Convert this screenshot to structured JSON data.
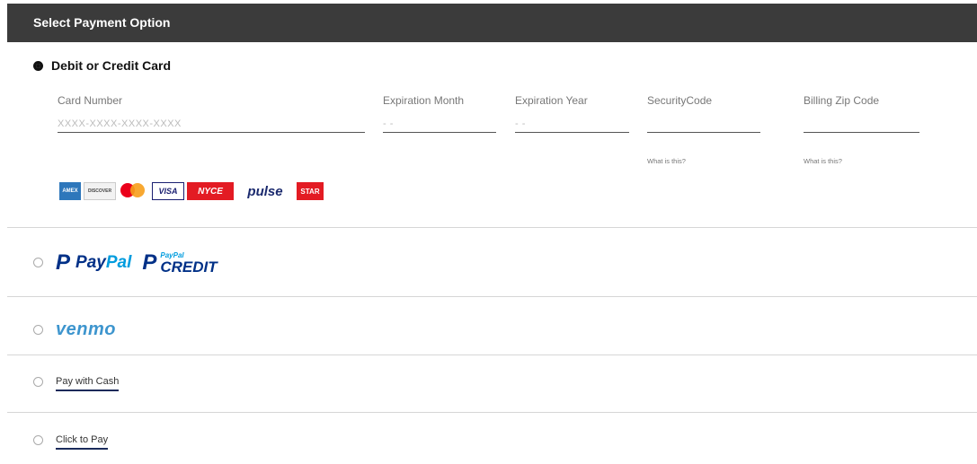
{
  "header": {
    "title": "Select Payment Option"
  },
  "card_option": {
    "title": "Debit or Credit Card",
    "selected": true,
    "fields": {
      "card_number": {
        "label": "Card Number",
        "placeholder": "XXXX-XXXX-XXXX-XXXX"
      },
      "exp_month": {
        "label": "Expiration Month",
        "placeholder": "- -"
      },
      "exp_year": {
        "label": "Expiration Year",
        "placeholder": "- -"
      },
      "security_code": {
        "label": "SecurityCode",
        "help": "What is this?"
      },
      "billing_zip": {
        "label": "Billing Zip Code",
        "help": "What is this?"
      }
    },
    "brands": {
      "amex": "AMEX",
      "discover": "DISCOVER",
      "mastercard": "mastercard",
      "visa": "VISA",
      "nyce": "NYCE",
      "pulse": "pulse",
      "star": "STAR"
    }
  },
  "paypal_option": {
    "selected": false,
    "paypal_text_a": "Pay",
    "paypal_text_b": "Pal",
    "credit_small": "PayPal",
    "credit_big": "CREDIT"
  },
  "venmo_option": {
    "selected": false,
    "label": "venmo"
  },
  "cash_option": {
    "selected": false,
    "label": "Pay with Cash"
  },
  "ctp_option": {
    "selected": false,
    "label": "Click to Pay"
  }
}
